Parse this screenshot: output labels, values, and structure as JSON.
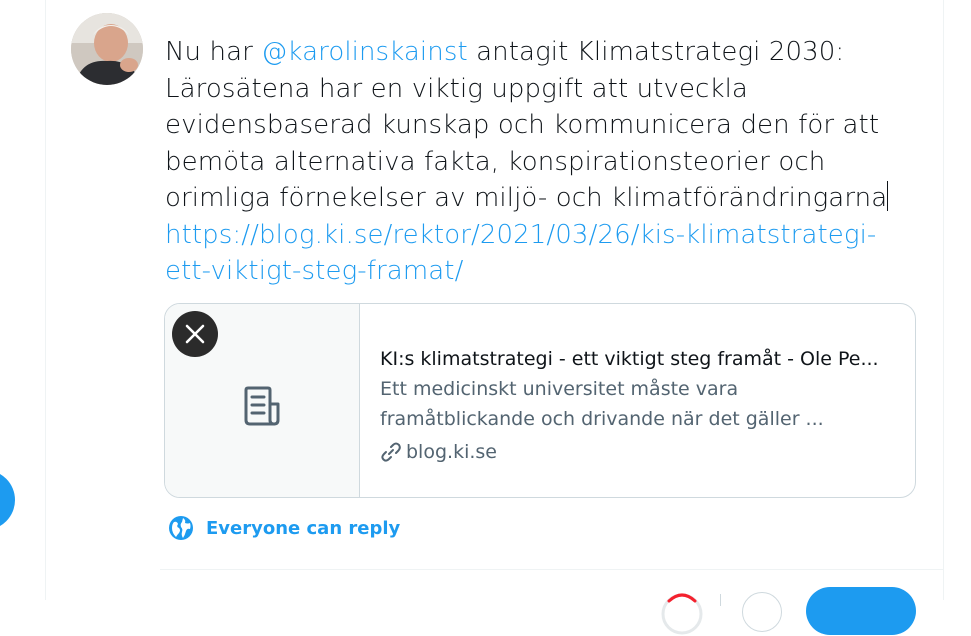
{
  "composer": {
    "avatar_icon": "user-avatar",
    "text_before_mention": "Nu har ",
    "mention": "@karolinskainst",
    "text_after_mention": " antagit Klimatstrategi 2030:",
    "line_2": "Lärosätena har en viktig uppgift att utveckla",
    "line_3": "evidensbaserad kunskap och kommunicera den för att",
    "line_4": "bemöta alternativa fakta, konspirationsteorier och",
    "line_5": "orimliga förnekelser av miljö- och klimatförändringarna",
    "url_line_1": "https://blog.ki.se/rektor/2021/03/26/kis-klimatstrategi-",
    "url_line_2": "ett-viktigt-steg-framat/"
  },
  "link_card": {
    "close_icon": "close-icon",
    "media_icon": "document-icon",
    "title": "KI:s klimatstrategi - ett viktigt steg framåt - Ole Pe...",
    "description_line_1": "Ett medicinskt universitet måste vara",
    "description_line_2": "framåtblickande och drivande när det gäller ...",
    "domain_icon": "link-icon",
    "domain": "blog.ki.se"
  },
  "reply_setting": {
    "icon": "globe-icon",
    "label": "Everyone can reply"
  },
  "toolbar": {
    "progress_icon": "character-count-ring",
    "add_icon": "add-tweet-icon",
    "tweet_label": ""
  },
  "colors": {
    "accent": "#1d9bf0",
    "text": "#0f1419",
    "secondary_text": "#536471",
    "border": "#cfd9de"
  }
}
